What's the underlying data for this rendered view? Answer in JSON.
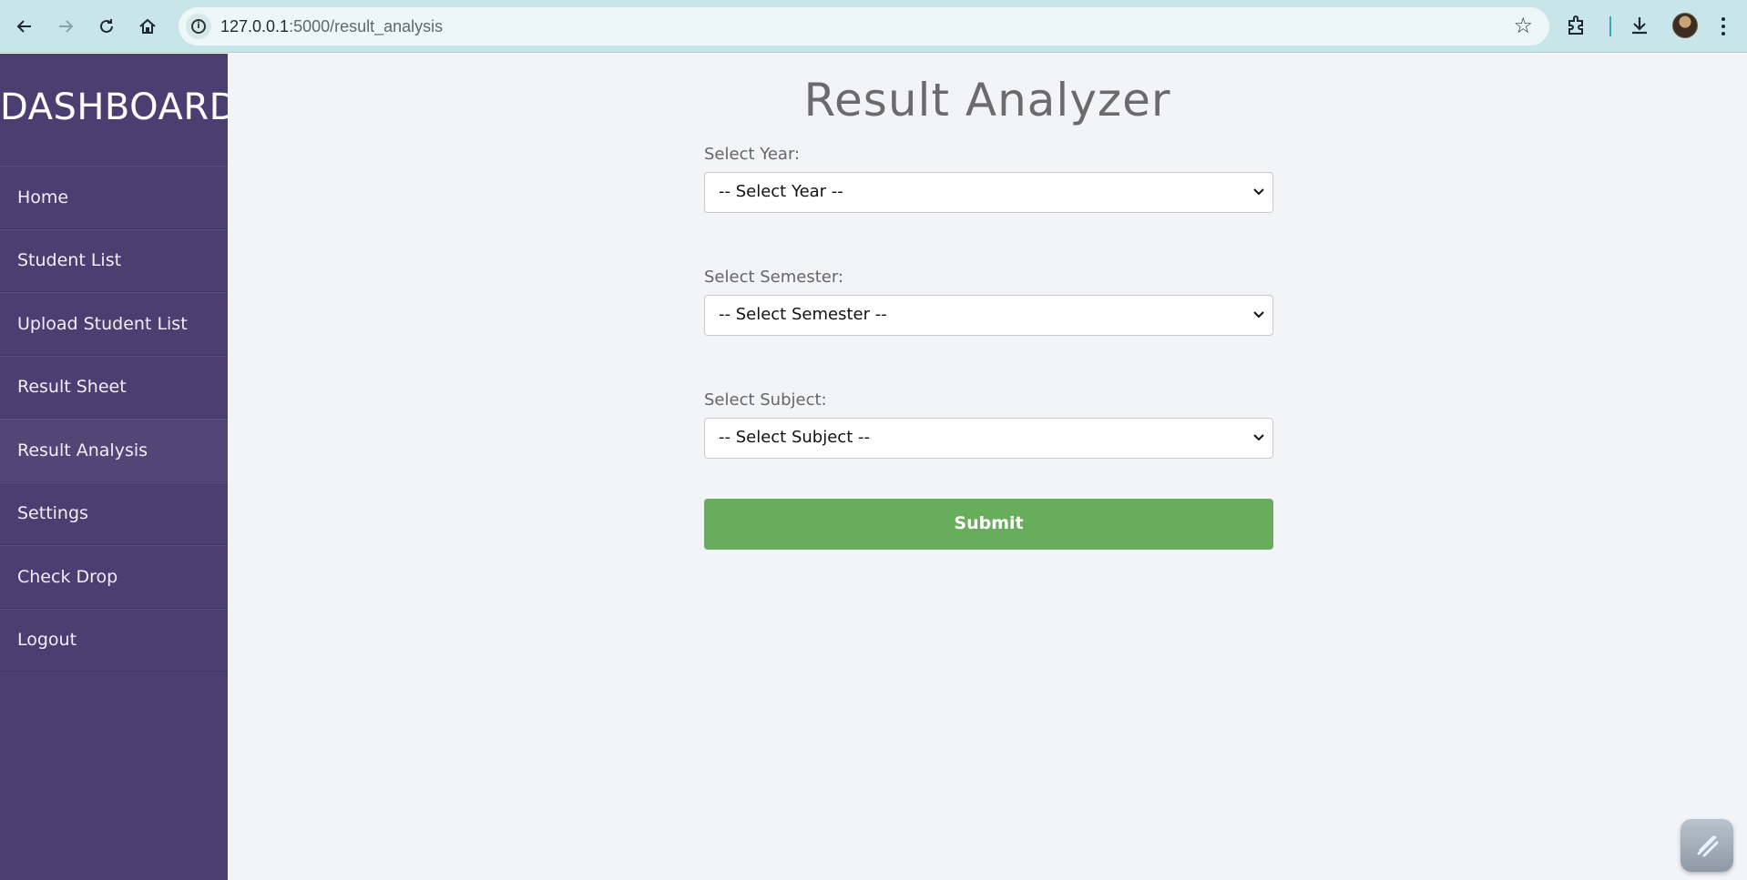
{
  "browser": {
    "url_host": "127.0.0.1",
    "url_rest": ":5000/result_analysis"
  },
  "sidebar": {
    "brand": "DASHBOARD",
    "items": [
      {
        "label": "Home"
      },
      {
        "label": "Student List"
      },
      {
        "label": "Upload Student List"
      },
      {
        "label": "Result Sheet"
      },
      {
        "label": "Result Analysis"
      },
      {
        "label": "Settings"
      },
      {
        "label": "Check Drop"
      },
      {
        "label": "Logout"
      }
    ]
  },
  "main": {
    "title": "Result Analyzer",
    "year": {
      "label": "Select Year:",
      "value": "-- Select Year --"
    },
    "semester": {
      "label": "Select Semester:",
      "value": "-- Select Semester --"
    },
    "subject": {
      "label": "Select Subject:",
      "value": "-- Select Subject --"
    },
    "submit_label": "Submit"
  },
  "colors": {
    "sidebar_bg": "#4b3f72",
    "main_bg": "#f3f4f8",
    "submit_bg": "#67ad5b",
    "browser_bar": "#c8e6ea"
  }
}
